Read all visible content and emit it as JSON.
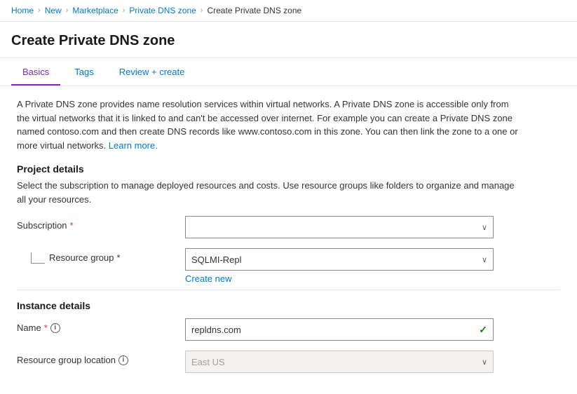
{
  "breadcrumb": {
    "items": [
      {
        "label": "Home",
        "link": true
      },
      {
        "label": "New",
        "link": true
      },
      {
        "label": "Marketplace",
        "link": true
      },
      {
        "label": "Private DNS zone",
        "link": true
      },
      {
        "label": "Create Private DNS zone",
        "link": false
      }
    ]
  },
  "page": {
    "title": "Create Private DNS zone"
  },
  "tabs": [
    {
      "label": "Basics",
      "active": true
    },
    {
      "label": "Tags",
      "active": false
    },
    {
      "label": "Review + create",
      "active": false
    }
  ],
  "description": {
    "text1": "A Private DNS zone provides name resolution services within virtual networks. A Private DNS zone is accessible only from the virtual networks that it is linked to and can't be accessed over internet. For example you can create a Private DNS zone named contoso.com and then create DNS records like www.contoso.com in this zone. You can then link the zone to a one or more virtual networks. ",
    "learn_more": "Learn more."
  },
  "project_details": {
    "header": "Project details",
    "desc": "Select the subscription to manage deployed resources and costs. Use resource groups like folders to organize and manage all your resources.",
    "subscription_label": "Subscription",
    "subscription_value": "",
    "resource_group_label": "Resource group",
    "resource_group_value": "SQLMI-Repl",
    "create_new_label": "Create new"
  },
  "instance_details": {
    "header": "Instance details",
    "name_label": "Name",
    "name_value": "repldns.com",
    "resource_group_location_label": "Resource group location",
    "resource_group_location_value": "East US"
  },
  "icons": {
    "chevron": "∨",
    "check": "✓",
    "info": "i",
    "separator": "›"
  }
}
